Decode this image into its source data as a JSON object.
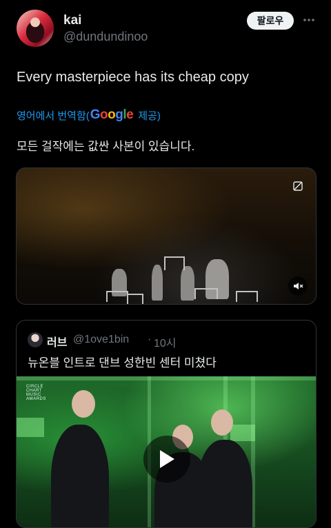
{
  "author": {
    "display_name": "kai",
    "handle": "@dundundinoo"
  },
  "actions": {
    "follow_label": "팔로우",
    "more_icon": "more-horizontal-icon"
  },
  "tweet": {
    "text": "Every masterpiece has its cheap copy",
    "translate_prefix": "영어에서 번역함(",
    "google": [
      "G",
      "o",
      "o",
      "g",
      "l",
      "e"
    ],
    "translate_suffix": "제공)",
    "translated_text": "모든 걸작에는 값싼 사본이 있습니다."
  },
  "media": {
    "gif_icon": "gif-off-icon",
    "mute_icon": "volume-mute-icon"
  },
  "quote": {
    "name": "러브",
    "handle": "@1ove1bin",
    "separator": "·",
    "time": "10시",
    "text": "뉴온블 인트로 댄브 성한빈 센터 미쳤다",
    "logo_lines": [
      "CIRCLE",
      "CHART",
      "MUSIC",
      "AWARDS"
    ],
    "play_icon": "play-icon"
  },
  "colors": {
    "background": "#000000",
    "link": "#1d9bf0",
    "secondary_text": "#71767b",
    "google_blue": "#4285f4",
    "google_red": "#ea4335",
    "google_yellow": "#fbbc05",
    "google_green": "#34a853"
  }
}
